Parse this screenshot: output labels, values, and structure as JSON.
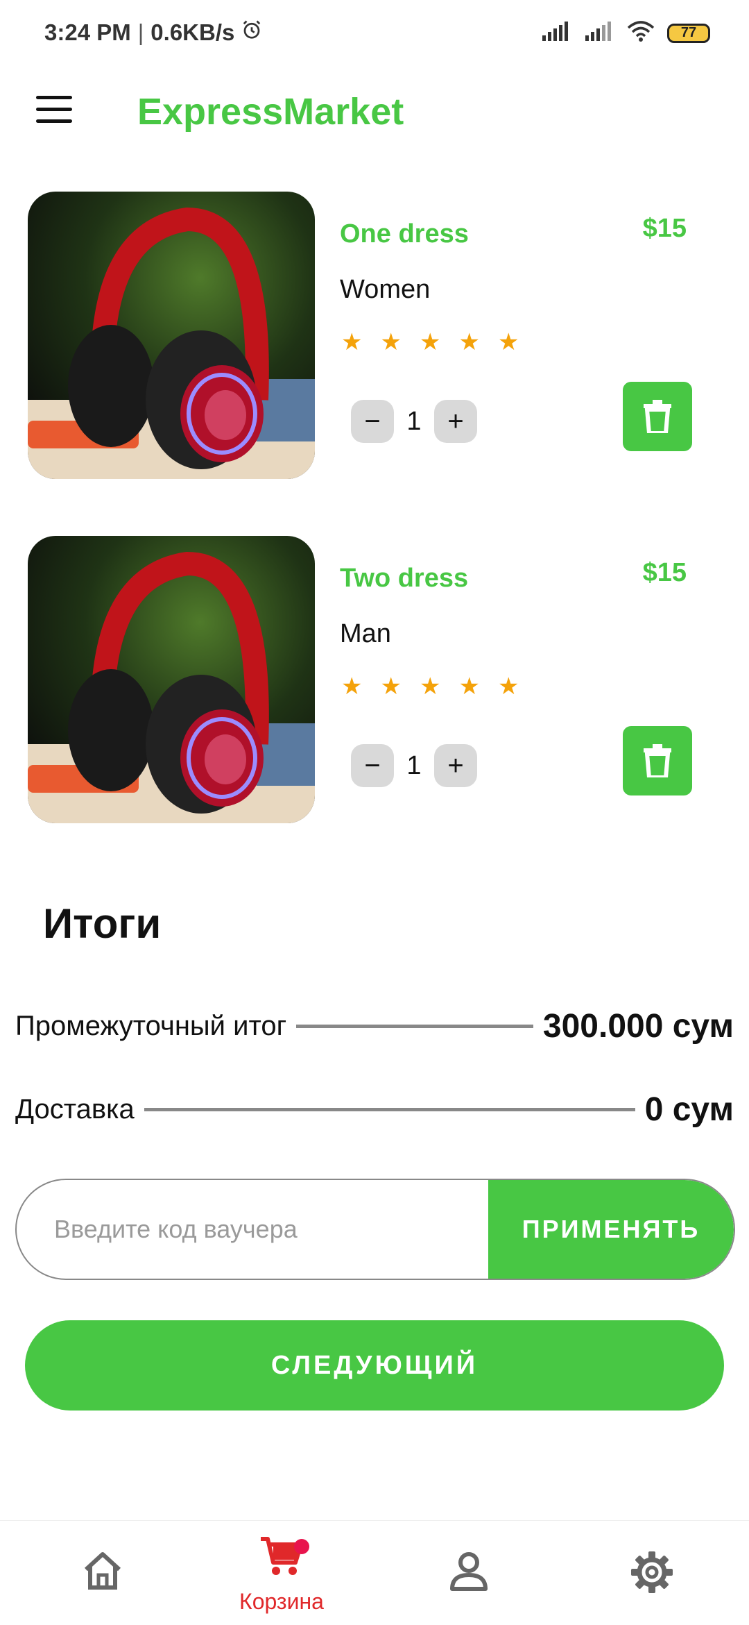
{
  "status_bar": {
    "time": "3:24 PM",
    "separator": "|",
    "speed": "0.6KB/s",
    "battery": "77",
    "icons": [
      "alarm-icon",
      "signal-icon",
      "signal-icon",
      "wifi-icon",
      "battery-icon"
    ]
  },
  "header": {
    "title": "ExpressMarket",
    "menu_icon": "hamburger-menu-icon"
  },
  "cart": {
    "items": [
      {
        "title": "One dress",
        "price": "$15",
        "category": "Women",
        "rating": 5,
        "quantity": "1",
        "image": "red-headphones-photo"
      },
      {
        "title": "Two dress",
        "price": "$15",
        "category": "Man",
        "rating": 5,
        "quantity": "1",
        "image": "red-headphones-photo"
      }
    ],
    "minus_symbol": "−",
    "plus_symbol": "+",
    "star_symbol": "★"
  },
  "totals": {
    "title": "Итоги",
    "subtotal_label": "Промежуточный итог",
    "subtotal_value": "300.000 сум",
    "delivery_label": "Доставка",
    "delivery_value": "0 сум"
  },
  "voucher": {
    "placeholder": "Введите код ваучера",
    "value": "",
    "apply_label": "ПРИМЕНЯТЬ"
  },
  "next_label": "СЛЕДУЮЩИЙ",
  "bottom_nav": {
    "active": "cart",
    "items": [
      {
        "id": "home",
        "icon": "home-icon",
        "label": ""
      },
      {
        "id": "cart",
        "icon": "cart-icon",
        "label": "Корзина"
      },
      {
        "id": "profile",
        "icon": "person-icon",
        "label": ""
      },
      {
        "id": "settings",
        "icon": "gear-icon",
        "label": ""
      }
    ]
  },
  "colors": {
    "accent": "#48c744",
    "star": "#f4a20a",
    "active_nav": "#e0282a",
    "badge": "#e8144d",
    "inactive_nav": "#666666"
  }
}
